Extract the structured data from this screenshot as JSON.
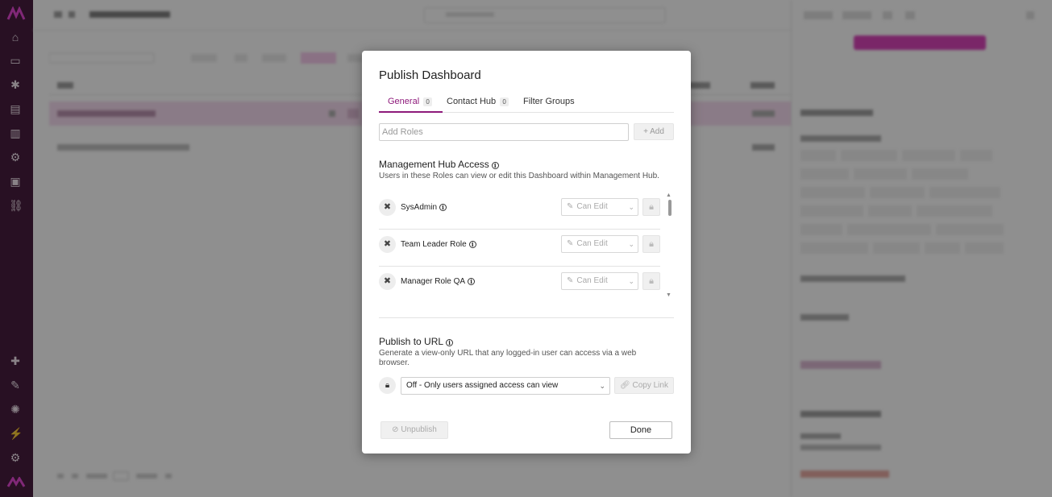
{
  "modal": {
    "title": "Publish Dashboard",
    "tabs": [
      {
        "label": "General",
        "badge": "0",
        "active": true
      },
      {
        "label": "Contact Hub",
        "badge": "0",
        "active": false
      },
      {
        "label": "Filter Groups",
        "active": false
      }
    ],
    "add_roles": {
      "placeholder": "Add Roles",
      "value": "",
      "button_label": "+ Add"
    },
    "management_hub": {
      "title": "Management Hub Access",
      "description": "Users in these Roles can view or edit this Dashboard within Management Hub.",
      "roles": [
        {
          "name": "SysAdmin",
          "permission": "Can Edit"
        },
        {
          "name": "Team Leader Role",
          "permission": "Can Edit"
        },
        {
          "name": "Manager Role QA",
          "permission": "Can Edit"
        }
      ]
    },
    "publish_url": {
      "title": "Publish to URL",
      "description": "Generate a view-only URL that any logged-in user can access via a web browser.",
      "selected_option": "Off - Only users assigned access can view",
      "copy_label": "Copy Link"
    },
    "unpublish_label": "Unpublish",
    "done_label": "Done"
  },
  "colors": {
    "accent": "#8e1a7b",
    "rail": "#3a0d30",
    "overlay": "rgba(20,20,20,0.48)"
  },
  "icons": {
    "role_avatar": "tools-icon",
    "info": "info-icon",
    "edit": "pencil-icon",
    "lock": "lock-icon",
    "unpublish": "ban-icon",
    "copy": "link-icon"
  }
}
